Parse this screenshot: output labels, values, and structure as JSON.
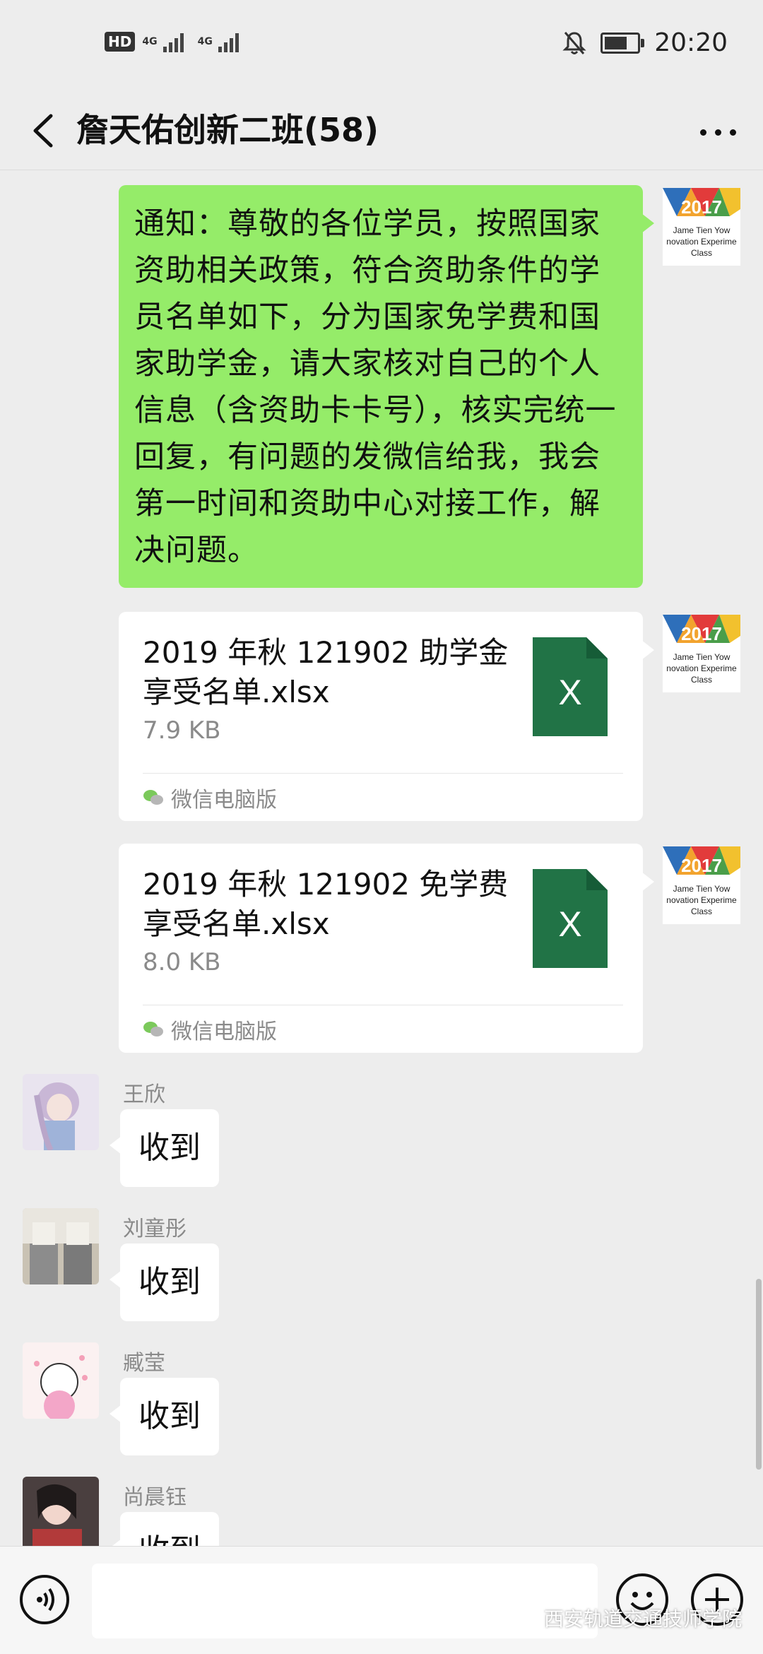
{
  "status_bar": {
    "hd_label": "HD",
    "sim1_label": "4G",
    "sim2_label": "4G",
    "time": "20:20",
    "battery_level_pct": 70
  },
  "header": {
    "title": "詹天佑创新二班(58)",
    "back_icon": "chevron-left-icon",
    "more_icon": "more-dots-icon"
  },
  "messages": {
    "notice": {
      "text": "通知：尊敬的各位学员，按照国家资助相关政策，符合资助条件的学员名单如下，分为国家免学费和国家助学金，请大家核对自己的个人信息（含资助卡卡号），核实完统一回复，有问题的发微信给我，我会第一时间和资助中心对接工作，解决问题。"
    },
    "avatar_text": {
      "year": "2017",
      "line1": "Jame Tien Yow",
      "line2": "novation Experime",
      "line3": "Class"
    },
    "files": [
      {
        "name": "2019 年秋 121902 助学金享受名单.xlsx",
        "size": "7.9 KB",
        "icon_letter": "X",
        "source": "微信电脑版"
      },
      {
        "name": "2019 年秋 121902 免学费享受名单.xlsx",
        "size": "8.0 KB",
        "icon_letter": "X",
        "source": "微信电脑版"
      }
    ],
    "replies": [
      {
        "sender": "王欣",
        "text": "收到"
      },
      {
        "sender": "刘童彤",
        "text": "收到"
      },
      {
        "sender": "臧莹",
        "text": "收到"
      },
      {
        "sender": "尚晨钰",
        "text": "收到"
      }
    ]
  },
  "input_bar": {
    "voice_icon": "voice-icon",
    "emoji_icon": "emoji-icon",
    "plus_icon": "plus-icon",
    "input_value": ""
  },
  "watermark": {
    "text": "西安轨道交通技师学院"
  },
  "colors": {
    "self_bubble": "#95ec69",
    "other_bubble": "#ffffff",
    "background": "#ededed",
    "excel_green": "#217346"
  }
}
